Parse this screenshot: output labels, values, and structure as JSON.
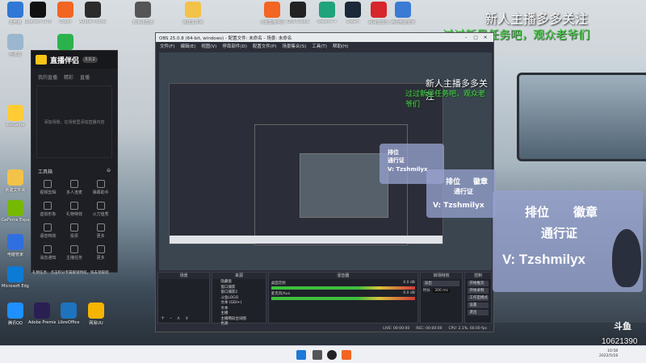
{
  "desktop": {
    "icons": [
      {
        "label": "此电脑",
        "color": "#2f78d6"
      },
      {
        "label": "Logitech G HUB",
        "color": "#111111"
      },
      {
        "label": "Origin",
        "color": "#f26522"
      },
      {
        "label": "Adobe Photoshop",
        "color": "#2b2b2b"
      },
      {
        "label": "Bilibili直播",
        "color": "#555555"
      },
      {
        "label": "新建文件夹",
        "color": "#f3c248"
      },
      {
        "label": "斗鱼直播伴侣",
        "color": "#f26522"
      },
      {
        "label": "OBS Studio",
        "color": "#222222"
      },
      {
        "label": "Steam++",
        "color": "#1fa37a"
      },
      {
        "label": "Steam",
        "color": "#1b2838"
      },
      {
        "label": "网易云音乐",
        "color": "#d7262c"
      },
      {
        "label": "腾讯电脑管家",
        "color": "#3a7bd5"
      },
      {
        "label": "回收站",
        "color": "#9bb6cf"
      },
      {
        "label": "QQ音乐",
        "color": "#2bb24c"
      },
      {
        "label": "Microsoft Edge",
        "color": "#0c7bd6"
      },
      {
        "label": "Adobe Premiere",
        "color": "#2a1f52"
      },
      {
        "label": "LibreOffice",
        "color": "#1e73be"
      },
      {
        "label": "网易UU",
        "color": "#f5b400"
      },
      {
        "label": "腾讯QQ",
        "color": "#1e90ff"
      },
      {
        "label": "新建文件夹",
        "color": "#f3c248"
      },
      {
        "label": "WeGame",
        "color": "#ffcc33"
      },
      {
        "label": "GeForce Experience",
        "color": "#76b900"
      },
      {
        "label": "电脑管家",
        "color": "#2f6fe0"
      }
    ]
  },
  "overlay": {
    "line1": "新人主播多多关注",
    "line2": "过过新星任务吧，观众老爷们"
  },
  "streaming_app": {
    "brand": "直播伴侣",
    "version": "3.0.2",
    "tabs": [
      "我的直播",
      "精彩",
      "直播",
      "设置"
    ],
    "scene_hint": "添加场景，在场景里添加直播内容",
    "tools_title": "工具箱",
    "tools": [
      "视频剪辑",
      "多人连麦",
      "弹幕助手",
      "虚拟形象",
      "礼物特效",
      "火力值秀",
      "语音特效",
      "投票",
      "更多",
      "消息通知",
      "主播任务",
      "更多"
    ],
    "notice": "礼物任务：点击积分专属解锁特权，快去领取吧"
  },
  "obs": {
    "title": "OBS 25.0.8 (64-bit, windows) - 配置文件: 未命名 - 场景: 未命名",
    "menu": [
      "文件(F)",
      "编辑(E)",
      "视图(V)",
      "停靠部件(D)",
      "配置文件(P)",
      "场景集合(S)",
      "工具(T)",
      "帮助(H)"
    ],
    "docks": {
      "scenes": "场景",
      "sources": "来源",
      "mixer": "混音器",
      "transitions": "转场特效",
      "controls": "控制"
    },
    "sources": [
      "隐藏窗",
      "窗口捕获",
      "窗口捕获2",
      "斗鱼LOGO",
      "文本 (GDI+)",
      "文本",
      "主播",
      "主播两段台词图",
      "色源"
    ],
    "mixer_tracks": [
      {
        "label": "桌面音频",
        "value": "0.0 dB"
      },
      {
        "label": "麦克风/Aux",
        "value": "0.0 dB"
      }
    ],
    "transition": {
      "type": "淡出",
      "duration_label": "时长",
      "duration": "300 ms"
    },
    "controls": [
      "开始推流",
      "开始录制",
      "工作室模式",
      "设置",
      "退出"
    ],
    "status": {
      "live": "LIVE: 00:00:00",
      "rec": "REC: 00:00:00",
      "cpu": "CPU: 2.1%, 60.00 fps"
    }
  },
  "badge": {
    "rank": "排位",
    "medal": "徽章",
    "pass": "通行证",
    "contact": "V: Tzshmilyx"
  },
  "watermark": {
    "platform": "斗鱼",
    "room_id": "10621390"
  },
  "taskbar": {
    "time": "10:58",
    "date": "2022/5/18"
  }
}
